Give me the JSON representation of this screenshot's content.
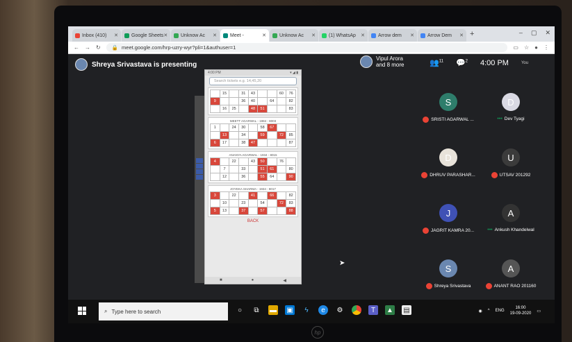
{
  "browser": {
    "tabs": [
      {
        "label": "Inbox (410)",
        "color": "#ea4335",
        "active": false
      },
      {
        "label": "Google Sheets",
        "color": "#0f9d58",
        "active": false
      },
      {
        "label": "Unknow Ac",
        "color": "#34a853",
        "active": false
      },
      {
        "label": "Meet - ",
        "color": "#00897b",
        "active": true
      },
      {
        "label": "Unknow Ac",
        "color": "#34a853",
        "active": false
      },
      {
        "label": "(1) WhatsAp",
        "color": "#25d366",
        "active": false
      },
      {
        "label": "Arrow dem",
        "color": "#4285f4",
        "active": false
      },
      {
        "label": "Arrow Dem",
        "color": "#4285f4",
        "active": false
      }
    ],
    "url": "meet.google.com/hrp-uzry-wyr?pli=1&authuser=1",
    "new_tab": "+"
  },
  "meet": {
    "presenting_text": "Shreya Srivastava is presenting",
    "participants_label": "Vipul Arora",
    "participants_more": "and 8 more",
    "people_count": "11",
    "chat_count": "2",
    "time": "4:00 PM",
    "you_label": "You"
  },
  "phone": {
    "status_left": "4:00 PM",
    "status_right": "▾ ◢ ▮",
    "search_placeholder": "Search tickets e.g. 14,45,20",
    "tickets": [
      {
        "title": "",
        "rows": [
          [
            "",
            "15",
            "",
            "31",
            "43",
            "",
            "",
            "60",
            "76"
          ],
          [
            "9",
            "",
            "",
            "36",
            "40",
            "",
            "64",
            "",
            "82"
          ],
          [
            "",
            "16",
            "25",
            "",
            "48",
            "51",
            "",
            "",
            "83"
          ]
        ],
        "hits": [
          [
            1,
            0
          ],
          [
            2,
            4
          ],
          [
            2,
            5
          ]
        ]
      },
      {
        "title": "MEETT AGARWAL - 1984 - 8003",
        "rows": [
          [
            "1",
            "",
            "24",
            "30",
            "",
            "58",
            "67",
            "",
            ""
          ],
          [
            "",
            "13",
            "",
            "34",
            "",
            "59",
            "",
            "72",
            "85"
          ],
          [
            "6",
            "17",
            "",
            "38",
            "47",
            "",
            "",
            "",
            "87"
          ]
        ],
        "hits": [
          [
            0,
            6
          ],
          [
            1,
            1
          ],
          [
            1,
            5
          ],
          [
            1,
            7
          ],
          [
            2,
            0
          ],
          [
            2,
            4
          ]
        ]
      },
      {
        "title": "ANANYA AGARWAL - 1934 - 8015",
        "rows": [
          [
            "4",
            "",
            "22",
            "",
            "43",
            "50",
            "",
            "76",
            ""
          ],
          [
            "",
            "7",
            "",
            "33",
            "",
            "51",
            "61",
            "",
            "80"
          ],
          [
            "",
            "12",
            "",
            "36",
            "",
            "55",
            "64",
            "",
            "90"
          ]
        ],
        "hits": [
          [
            0,
            0
          ],
          [
            0,
            5
          ],
          [
            1,
            5
          ],
          [
            1,
            6
          ],
          [
            2,
            5
          ],
          [
            2,
            8
          ]
        ]
      },
      {
        "title": "JOYEKA SHARMA - 1934 - 8017",
        "rows": [
          [
            "3",
            "",
            "22",
            "",
            "41",
            "",
            "66",
            "",
            "82"
          ],
          [
            "",
            "10",
            "",
            "23",
            "",
            "54",
            "",
            "72",
            "83"
          ],
          [
            "5",
            "13",
            "",
            "37",
            "",
            "57",
            "",
            "",
            "88"
          ]
        ],
        "hits": [
          [
            0,
            0
          ],
          [
            0,
            4
          ],
          [
            0,
            6
          ],
          [
            1,
            7
          ],
          [
            2,
            0
          ],
          [
            2,
            3
          ],
          [
            2,
            5
          ],
          [
            2,
            8
          ]
        ]
      }
    ],
    "back_label": "BACK",
    "nav": [
      "■",
      "●",
      "◀"
    ]
  },
  "participants": [
    {
      "name": "SRISTI AGARWAL ...",
      "initial": "S",
      "color": "#2e7d6b",
      "muted": true
    },
    {
      "name": "Dev Tyagi",
      "initial": "D",
      "color": "#d9d9e3",
      "muted": false
    },
    {
      "name": "DHRUV PARASHAR...",
      "initial": "D",
      "color": "#e8e3da",
      "muted": true
    },
    {
      "name": "UTSAV 201292",
      "initial": "U",
      "color": "#3b3b3b",
      "muted": true
    },
    {
      "name": "JAGRIT KAMRA 20...",
      "initial": "J",
      "color": "#3f51b5",
      "muted": true
    },
    {
      "name": "Ankush Khandelwal",
      "initial": "A",
      "color": "#333333",
      "muted": false
    },
    {
      "name": "Shreya Srivastava",
      "initial": "S",
      "color": "#6a87b0",
      "muted": true
    },
    {
      "name": "ANANT RAO 201160",
      "initial": "A",
      "color": "#555555",
      "muted": true
    }
  ],
  "taskbar": {
    "search_placeholder": "Type here to search",
    "lang": "ENG",
    "time": "16:00",
    "date": "19-09-2020"
  },
  "brand": "hp"
}
